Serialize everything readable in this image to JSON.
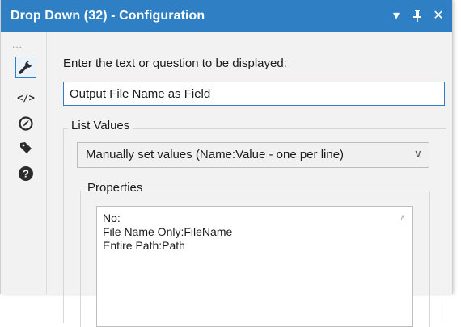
{
  "window": {
    "title": "Drop Down (32) - Configuration",
    "controls": {
      "dropdown_glyph": "▾",
      "pin_glyph": "⨄",
      "close_glyph": "✕"
    }
  },
  "sidebar": {
    "grip": "...",
    "items": [
      {
        "name": "wrench-icon",
        "active": true
      },
      {
        "name": "code-icon",
        "glyph": "</>"
      },
      {
        "name": "compass-icon"
      },
      {
        "name": "tag-icon"
      },
      {
        "name": "help-icon",
        "glyph": "?"
      }
    ]
  },
  "main": {
    "prompt_label": "Enter the text or question to be displayed:",
    "prompt_value": "Output File Name as Field",
    "list_values_label": "List Values",
    "list_values_selected": "Manually set values (Name:Value - one per line)",
    "list_values_caret": "∨",
    "properties_label": "Properties",
    "properties_lines": [
      "No:",
      "File Name Only:FileName",
      "Entire Path:Path"
    ],
    "scroll_up_glyph": "∧"
  },
  "colors": {
    "titlebar": "#2f7fc4",
    "accent_border": "#2f7fc4",
    "panel_bg": "#f2f2f2",
    "icon_dark": "#333333"
  }
}
